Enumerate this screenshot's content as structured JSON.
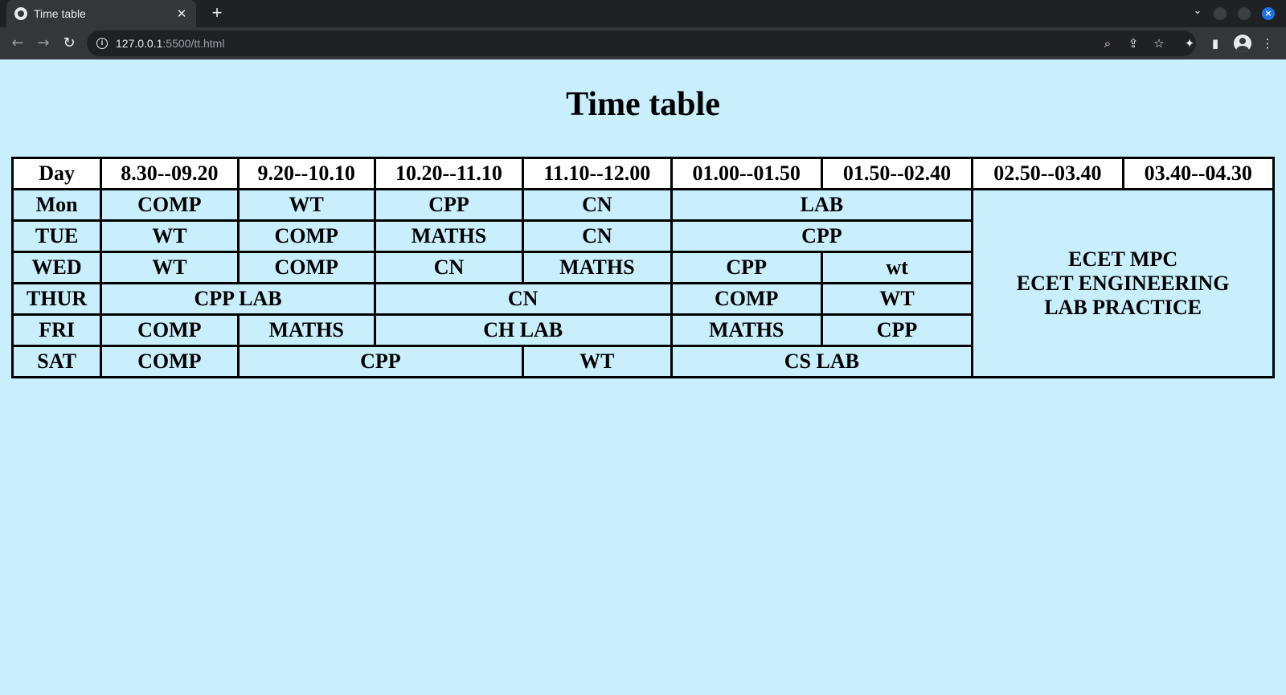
{
  "browser": {
    "tab_title": "Time table",
    "url_host": "127.0.0.1",
    "url_path": ":5500/tt.html"
  },
  "page": {
    "title": "Time table"
  },
  "timetable": {
    "header": [
      "Day",
      "8.30--09.20",
      "9.20--10.10",
      "10.20--11.10",
      "11.10--12.00",
      "01.00--01.50",
      "01.50--02.40",
      "02.50--03.40",
      "03.40--04.30"
    ],
    "rows": {
      "mon": {
        "day": "Mon",
        "c1": "COMP",
        "c2": "WT",
        "c3": "CPP",
        "c4": "CN",
        "c5": "LAB"
      },
      "tue": {
        "day": "TUE",
        "c1": "WT",
        "c2": "COMP",
        "c3": "MATHS",
        "c4": "CN",
        "c5": "CPP"
      },
      "wed": {
        "day": "WED",
        "c1": "WT",
        "c2": "COMP",
        "c3": "CN",
        "c4": "MATHS",
        "c5": "CPP",
        "c6": "wt"
      },
      "thur": {
        "day": "THUR",
        "c1": "CPP LAB",
        "c2": "CN",
        "c3": "COMP",
        "c4": "WT"
      },
      "fri": {
        "day": "FRI",
        "c1": "COMP",
        "c2": "MATHS",
        "c3": "CH LAB",
        "c4": "MATHS",
        "c5": "CPP"
      },
      "sat": {
        "day": "SAT",
        "c1": "COMP",
        "c2": "CPP",
        "c3": "WT",
        "c4": "CS LAB"
      }
    },
    "afternoon_note": [
      "ECET MPC",
      "ECET ENGINEERING",
      "LAB PRACTICE"
    ]
  }
}
